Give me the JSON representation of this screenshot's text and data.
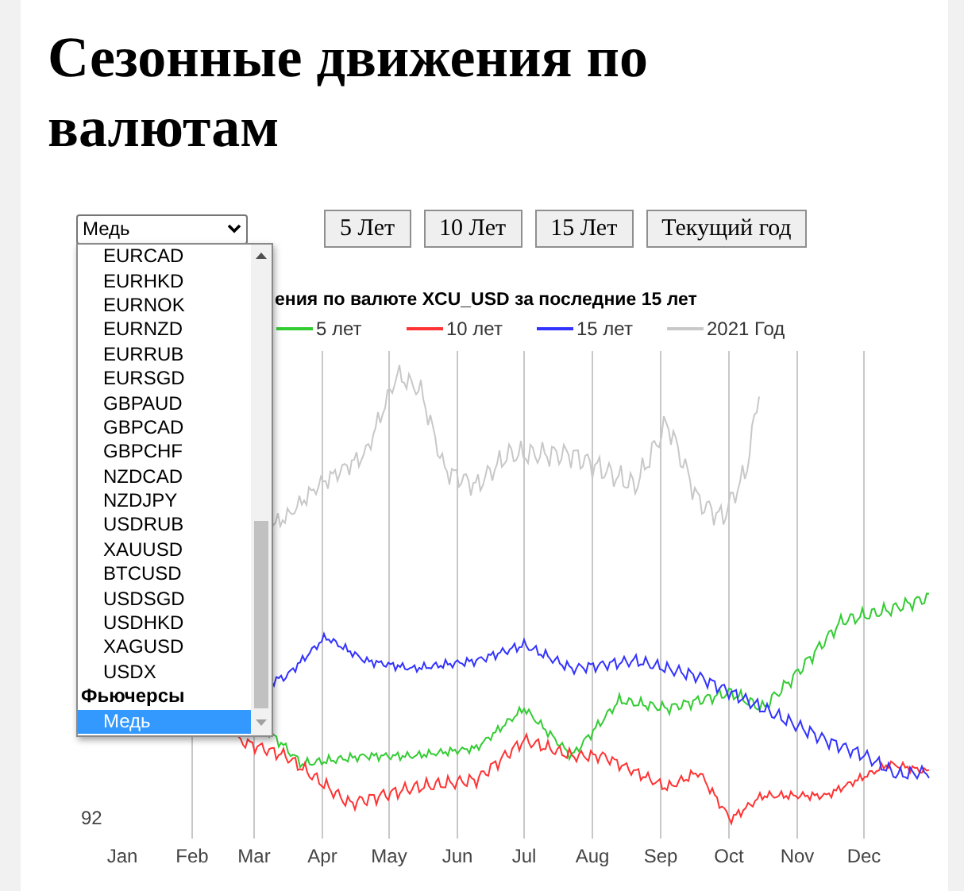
{
  "title": "Сезонные движения по валютам",
  "select": {
    "value": "Медь"
  },
  "buttons": [
    "5 Лет",
    "10 Лет",
    "15 Лет",
    "Текущий год"
  ],
  "dropdown": {
    "items": [
      {
        "kind": "option",
        "label": "EURCAD",
        "selected": false
      },
      {
        "kind": "option",
        "label": "EURHKD",
        "selected": false
      },
      {
        "kind": "option",
        "label": "EURNOK",
        "selected": false
      },
      {
        "kind": "option",
        "label": "EURNZD",
        "selected": false
      },
      {
        "kind": "option",
        "label": "EURRUB",
        "selected": false
      },
      {
        "kind": "option",
        "label": "EURSGD",
        "selected": false
      },
      {
        "kind": "option",
        "label": "GBPAUD",
        "selected": false
      },
      {
        "kind": "option",
        "label": "GBPCAD",
        "selected": false
      },
      {
        "kind": "option",
        "label": "GBPCHF",
        "selected": false
      },
      {
        "kind": "option",
        "label": "NZDCAD",
        "selected": false
      },
      {
        "kind": "option",
        "label": "NZDJPY",
        "selected": false
      },
      {
        "kind": "option",
        "label": "USDRUB",
        "selected": false
      },
      {
        "kind": "option",
        "label": "XAUUSD",
        "selected": false
      },
      {
        "kind": "option",
        "label": "BTCUSD",
        "selected": false
      },
      {
        "kind": "option",
        "label": "USDSGD",
        "selected": false
      },
      {
        "kind": "option",
        "label": "USDHKD",
        "selected": false
      },
      {
        "kind": "option",
        "label": "XAGUSD",
        "selected": false
      },
      {
        "kind": "option",
        "label": "USDX",
        "selected": false
      },
      {
        "kind": "group",
        "label": "Фьючерсы"
      },
      {
        "kind": "option",
        "label": "Медь",
        "selected": true
      }
    ]
  },
  "chart": {
    "title": "ения по валюте XCU_USD за последние 15 лет",
    "legend": [
      {
        "label": "5 лет",
        "color": "#33cc33"
      },
      {
        "label": "10 лет",
        "color": "#ff3333"
      },
      {
        "label": "15 лет",
        "color": "#3333ff"
      },
      {
        "label": "2021 Год",
        "color": "#c8c8c8"
      }
    ],
    "y_labels": [
      "92"
    ],
    "months": [
      "Jan",
      "Feb",
      "Mar",
      "Apr",
      "May",
      "Jun",
      "Jul",
      "Aug",
      "Sep",
      "Oct",
      "Nov",
      "Dec"
    ]
  }
}
